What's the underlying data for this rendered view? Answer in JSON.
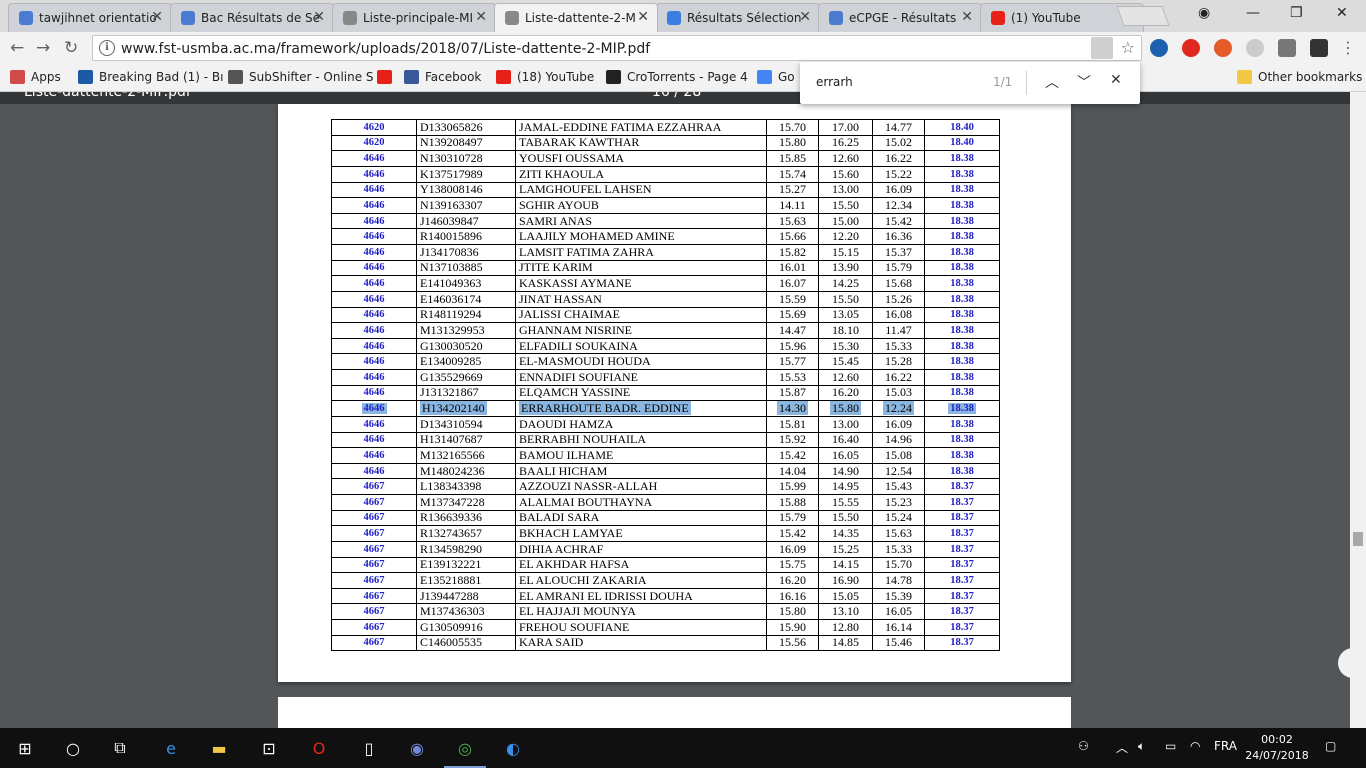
{
  "tabs": [
    {
      "label": "tawjihnet orientatio",
      "color": "#4a7bd0"
    },
    {
      "label": "Bac Résultats de Se",
      "color": "#4a7bd0"
    },
    {
      "label": "Liste-principale-MI",
      "color": "#888888"
    },
    {
      "label": "Liste-dattente-2-M",
      "color": "#888888"
    },
    {
      "label": "Résultats Sélection",
      "color": "#3b7de0"
    },
    {
      "label": "eCPGE - Résultats",
      "color": "#4a7bd0"
    },
    {
      "label": "(1) YouTube",
      "color": "#e62117"
    }
  ],
  "url": "www.fst-usmba.ac.ma/framework/uploads/2018/07/Liste-dattente-2-MIP.pdf",
  "bookmarks": [
    {
      "label": "Apps",
      "icon": "apps-grid-icon",
      "color": "#d04a4a"
    },
    {
      "label": "Breaking Bad (1) - Bı",
      "icon": "bs-icon",
      "color": "#1c5aa8"
    },
    {
      "label": "SubShifter - Online S",
      "icon": "s-icon",
      "color": "#555555"
    },
    {
      "label": "",
      "icon": "youtube-icon",
      "color": "#e62117"
    },
    {
      "label": "Facebook",
      "icon": "facebook-icon",
      "color": "#3b5998"
    },
    {
      "label": "(18) YouTube",
      "icon": "youtube-icon",
      "color": "#e62117"
    },
    {
      "label": "CroTorrents - Page 4",
      "icon": "torrent-icon",
      "color": "#222222"
    },
    {
      "label": "Go",
      "icon": "google-icon",
      "color": "#4285f4"
    }
  ],
  "other_bookmarks": "Other bookmarks",
  "pdf": {
    "title": "Liste-dattente-2-MIP.pdf",
    "page": "16 / 28"
  },
  "find": {
    "query": "errarh",
    "count": "1/1"
  },
  "rows": [
    [
      "4620",
      "D133065826",
      "JAMAL-EDDINE FATIMA EZZAHRAA",
      "15.70",
      "17.00",
      "14.77",
      "18.40"
    ],
    [
      "4620",
      "N139208497",
      "TABARAK KAWTHAR",
      "15.80",
      "16.25",
      "15.02",
      "18.40"
    ],
    [
      "4646",
      "N130310728",
      "YOUSFI OUSSAMA",
      "15.85",
      "12.60",
      "16.22",
      "18.38"
    ],
    [
      "4646",
      "K137517989",
      "ZITI KHAOULA",
      "15.74",
      "15.60",
      "15.22",
      "18.38"
    ],
    [
      "4646",
      "Y138008146",
      "LAMGHOUFEL LAHSEN",
      "15.27",
      "13.00",
      "16.09",
      "18.38"
    ],
    [
      "4646",
      "N139163307",
      "SGHIR AYOUB",
      "14.11",
      "15.50",
      "12.34",
      "18.38"
    ],
    [
      "4646",
      "J146039847",
      "SAMRI ANAS",
      "15.63",
      "15.00",
      "15.42",
      "18.38"
    ],
    [
      "4646",
      "R140015896",
      "LAAJILY MOHAMED AMINE",
      "15.66",
      "12.20",
      "16.36",
      "18.38"
    ],
    [
      "4646",
      "J134170836",
      "LAMSIT FATIMA ZAHRA",
      "15.82",
      "15.15",
      "15.37",
      "18.38"
    ],
    [
      "4646",
      "N137103885",
      "JTITE KARIM",
      "16.01",
      "13.90",
      "15.79",
      "18.38"
    ],
    [
      "4646",
      "E141049363",
      "KASKASSI AYMANE",
      "16.07",
      "14.25",
      "15.68",
      "18.38"
    ],
    [
      "4646",
      "E146036174",
      "JINAT HASSAN",
      "15.59",
      "15.50",
      "15.26",
      "18.38"
    ],
    [
      "4646",
      "R148119294",
      "JALISSI CHAIMAE",
      "15.69",
      "13.05",
      "16.08",
      "18.38"
    ],
    [
      "4646",
      "M131329953",
      "GHANNAM NISRINE",
      "14.47",
      "18.10",
      "11.47",
      "18.38"
    ],
    [
      "4646",
      "G130030520",
      "ELFADILI SOUKAINA",
      "15.96",
      "15.30",
      "15.33",
      "18.38"
    ],
    [
      "4646",
      "E134009285",
      "EL-MASMOUDI HOUDA",
      "15.77",
      "15.45",
      "15.28",
      "18.38"
    ],
    [
      "4646",
      "G135529669",
      "ENNADIFI SOUFIANE",
      "15.53",
      "12.60",
      "16.22",
      "18.38"
    ],
    [
      "4646",
      "J131321867",
      "ELQAMCH YASSINE",
      "15.87",
      "16.20",
      "15.03",
      "18.38"
    ],
    [
      "4646",
      "H134202140",
      "ERRARHOUTE BADR. EDDINE",
      "14.30",
      "15.80",
      "12.24",
      "18.38"
    ],
    [
      "4646",
      "D134310594",
      "DAOUDI HAMZA",
      "15.81",
      "13.00",
      "16.09",
      "18.38"
    ],
    [
      "4646",
      "H131407687",
      "BERRABHI NOUHAILA",
      "15.92",
      "16.40",
      "14.96",
      "18.38"
    ],
    [
      "4646",
      "M132165566",
      "BAMOU ILHAME",
      "15.42",
      "16.05",
      "15.08",
      "18.38"
    ],
    [
      "4646",
      "M148024236",
      "BAALI HICHAM",
      "14.04",
      "14.90",
      "12.54",
      "18.38"
    ],
    [
      "4667",
      "L138343398",
      "AZZOUZI NASSR-ALLAH",
      "15.99",
      "14.95",
      "15.43",
      "18.37"
    ],
    [
      "4667",
      "M137347228",
      "ALALMAI BOUTHAYNA",
      "15.88",
      "15.55",
      "15.23",
      "18.37"
    ],
    [
      "4667",
      "R136639336",
      "BALADI SARA",
      "15.79",
      "15.50",
      "15.24",
      "18.37"
    ],
    [
      "4667",
      "R132743657",
      "BKHACH LAMYAE",
      "15.42",
      "14.35",
      "15.63",
      "18.37"
    ],
    [
      "4667",
      "R134598290",
      "DIHIA ACHRAF",
      "16.09",
      "15.25",
      "15.33",
      "18.37"
    ],
    [
      "4667",
      "E139132221",
      "EL AKHDAR HAFSA",
      "15.75",
      "14.15",
      "15.70",
      "18.37"
    ],
    [
      "4667",
      "E135218881",
      "EL ALOUCHI ZAKARIA",
      "16.20",
      "16.90",
      "14.78",
      "18.37"
    ],
    [
      "4667",
      "J139447288",
      "EL AMRANI EL IDRISSI DOUHA",
      "16.16",
      "15.05",
      "15.39",
      "18.37"
    ],
    [
      "4667",
      "M137436303",
      "EL HAJJAJI MOUNYA",
      "15.80",
      "13.10",
      "16.05",
      "18.37"
    ],
    [
      "4667",
      "G130509916",
      "FREHOU SOUFIANE",
      "15.90",
      "12.80",
      "16.14",
      "18.37"
    ],
    [
      "4667",
      "C146005535",
      "KARA SAID",
      "15.56",
      "14.85",
      "15.46",
      "18.37"
    ]
  ],
  "highlight_row": 18,
  "taskbar": {
    "lang": "FRA",
    "time": "00:02",
    "date": "24/07/2018"
  }
}
